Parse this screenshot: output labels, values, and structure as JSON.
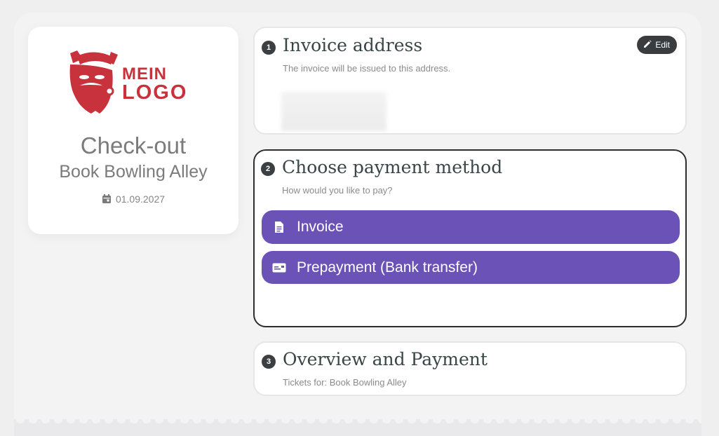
{
  "logo": {
    "line1": "MEIN",
    "line2": "LOGO",
    "color": "#c8323c"
  },
  "summary": {
    "title": "Check-out",
    "subtitle": "Book Bowling Alley",
    "date": "01.09.2027"
  },
  "steps": [
    {
      "number": "1",
      "title": "Invoice address",
      "description": "The invoice will be issued to this address.",
      "edit_label": "Edit"
    },
    {
      "number": "2",
      "title": "Choose payment method",
      "description": "How would you like to pay?",
      "options": [
        {
          "label": "Invoice",
          "icon": "document-icon"
        },
        {
          "label": "Prepayment (Bank transfer)",
          "icon": "bank-card-icon"
        }
      ]
    },
    {
      "number": "3",
      "title": "Overview and Payment",
      "description": "Tickets for: Book Bowling Alley"
    }
  ],
  "colors": {
    "accent": "#6b52b6",
    "dark": "#3a3d40",
    "active_border": "#2d2d2d"
  }
}
